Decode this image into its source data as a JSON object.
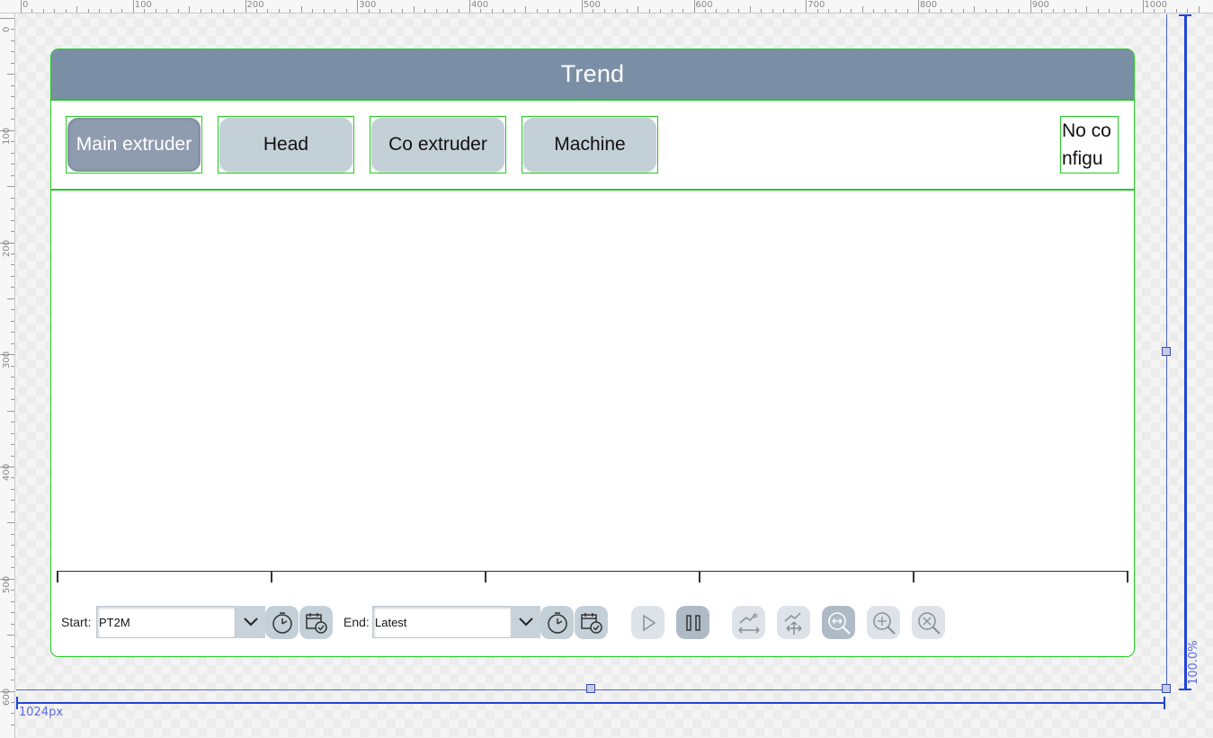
{
  "ruler": {
    "top_labels": [
      "0",
      "100",
      "200",
      "300",
      "400",
      "500",
      "600",
      "700",
      "800",
      "900",
      "1000"
    ],
    "left_labels": [
      "0",
      "100",
      "200",
      "300",
      "400",
      "500",
      "600"
    ]
  },
  "dimensions": {
    "width_label": "1024px",
    "height_label": "100.0%"
  },
  "page": {
    "title": "Trend",
    "tabs": [
      {
        "label": "Main extruder",
        "active": true
      },
      {
        "label": "Head",
        "active": false
      },
      {
        "label": "Co extruder",
        "active": false
      },
      {
        "label": "Machine",
        "active": false
      }
    ],
    "config_text": "No configu"
  },
  "toolbar": {
    "start_label": "Start:",
    "start_value": "PT2M",
    "end_label": "End:",
    "end_value": "Latest"
  },
  "icons": {
    "dropdown": "chevron-down-icon",
    "clock": "clock-icon",
    "calendar": "calendar-clock-icon",
    "play": "play-icon",
    "pause": "pause-icon",
    "zoom_x": "zoom-x-icon",
    "pan": "pan-icon",
    "zoom_fit": "zoom-fit-icon",
    "zoom_in": "zoom-in-icon",
    "zoom_reset": "zoom-reset-icon"
  },
  "colors": {
    "title_bar": "#7a8fa6",
    "tab_background": "#c4d0d8",
    "tab_active": "#8f9caf",
    "outline": "#22cc22",
    "guide": "#2044d8"
  }
}
